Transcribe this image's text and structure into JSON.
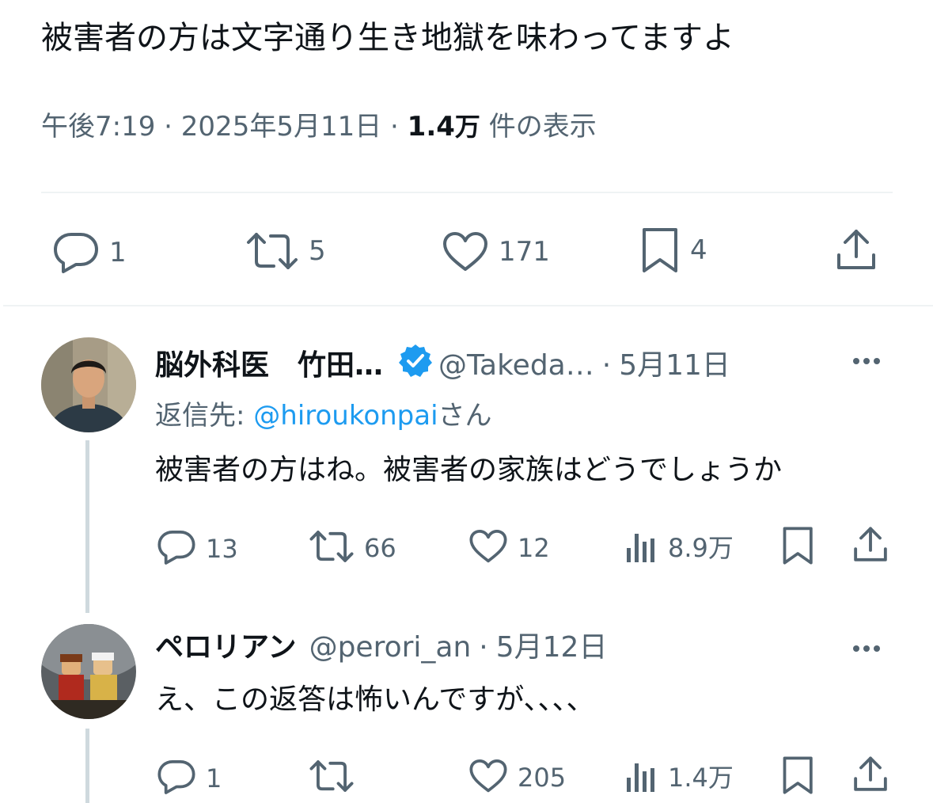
{
  "tweet": {
    "text": "被害者の方は文字通り生き地獄を味わってますよ",
    "time": "午後7:19",
    "date": "2025年5月11日",
    "views_value": "1.4",
    "views_unit": "万",
    "views_label": "件の表示",
    "separator": "·",
    "actions": {
      "reply_count": "1",
      "retweet_count": "5",
      "like_count": "171",
      "bookmark_count": "4"
    }
  },
  "replies": [
    {
      "name": "脳外科医　竹田…",
      "verified": true,
      "handle": "@Takeda…",
      "separator": "·",
      "date": "5月11日",
      "replying_prefix": "返信先: ",
      "replying_to": "@hiroukonpai",
      "replying_suffix": "さん",
      "text": "被害者の方はね。被害者の家族はどうでしょうか",
      "counts": {
        "reply": "13",
        "retweet": "66",
        "like": "12",
        "views": "8.9万"
      }
    },
    {
      "name": "ペロリアン",
      "verified": false,
      "handle": "@perori_an",
      "separator": "·",
      "date": "5月12日",
      "text": "え、この返答は怖いんですが、、、、",
      "counts": {
        "reply": "1",
        "retweet": "",
        "like": "205",
        "views": "1.4万"
      }
    }
  ],
  "colors": {
    "text_primary": "#0f1419",
    "text_secondary": "#536471",
    "link": "#1d9bf0",
    "verified": "#1d9bf0",
    "divider": "#eff3f4",
    "thread_line": "#cfd9de"
  },
  "icons": [
    "reply-icon",
    "retweet-icon",
    "like-icon",
    "bookmark-icon",
    "share-icon",
    "views-icon",
    "verified-badge-icon",
    "more-icon"
  ]
}
